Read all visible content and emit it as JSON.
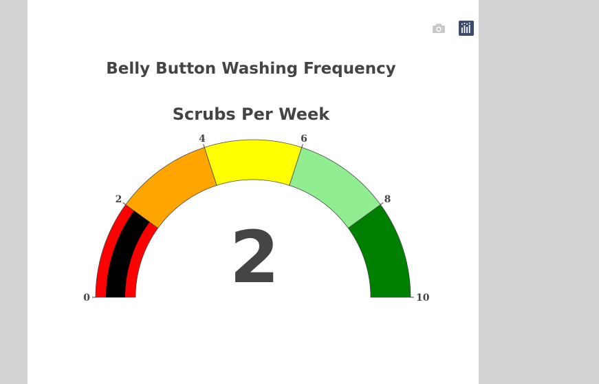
{
  "modebar": {
    "camera_icon": "camera-icon",
    "plotly_icon": "plotly-logo-icon"
  },
  "chart_data": {
    "type": "gauge",
    "title": "Belly Button Washing Frequency",
    "subtitle": "Scrubs Per Week",
    "value": 2,
    "value_label": "2",
    "range": [
      0,
      10
    ],
    "ticks": [
      {
        "value": 0,
        "label": "0"
      },
      {
        "value": 2,
        "label": "2"
      },
      {
        "value": 4,
        "label": "4"
      },
      {
        "value": 6,
        "label": "6"
      },
      {
        "value": 8,
        "label": "8"
      },
      {
        "value": 10,
        "label": "10"
      }
    ],
    "steps": [
      {
        "range": [
          0,
          2
        ],
        "color": "#ff0000"
      },
      {
        "range": [
          2,
          4
        ],
        "color": "#ffa500"
      },
      {
        "range": [
          4,
          6
        ],
        "color": "#ffff00"
      },
      {
        "range": [
          6,
          8
        ],
        "color": "#90ee90"
      },
      {
        "range": [
          8,
          10
        ],
        "color": "#008000"
      }
    ],
    "bar_color": "#000000",
    "value_color": "#444444"
  }
}
